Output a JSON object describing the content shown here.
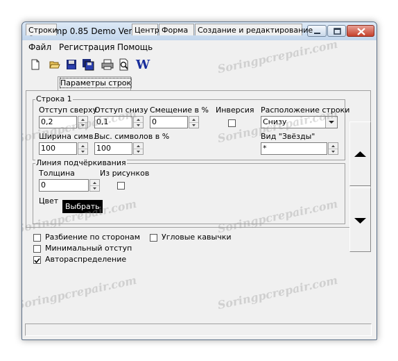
{
  "window": {
    "title": "Stamp 0.85 Demo Version"
  },
  "menu": [
    "Файл",
    "Регистрация",
    "Помощь"
  ],
  "toolbar": {
    "word_icon_text": "W"
  },
  "tabs": [
    "Строки",
    "Параметры строк",
    "Центр",
    "Форма",
    "Создание и редактирование"
  ],
  "line_group": {
    "legend": "Строка 1",
    "indent_top_label": "Отступ сверху",
    "indent_top_value": "0,2",
    "indent_bottom_label": "Отступ снизу",
    "indent_bottom_value": "0,1",
    "shift_label": "Смещение в %",
    "shift_value": "0",
    "inversion_label": "Инверсия",
    "position_label": "Расположение строки",
    "position_value": "Снизу",
    "char_width_label": "Ширина симв.",
    "char_width_value": "100",
    "char_height_label": "Выс. символов в %",
    "char_height_value": "100",
    "stars_label": "Вид \"Звёзды\"",
    "stars_value": "*"
  },
  "underline_group": {
    "legend": "Линия подчёркивания",
    "thickness_label": "Толщина",
    "thickness_value": "0",
    "from_pictures_label": "Из рисунков",
    "color_label": "Цвет",
    "tooltip": "Выбрать"
  },
  "options": [
    {
      "label": "Разбиение по сторонам",
      "checked": false
    },
    {
      "label": "Угловые кавычки",
      "checked": false
    },
    {
      "label": "Минимальный отступ",
      "checked": false
    },
    {
      "label": "Автораспределение",
      "checked": true
    }
  ],
  "watermark": "Soringpcrepair.com"
}
